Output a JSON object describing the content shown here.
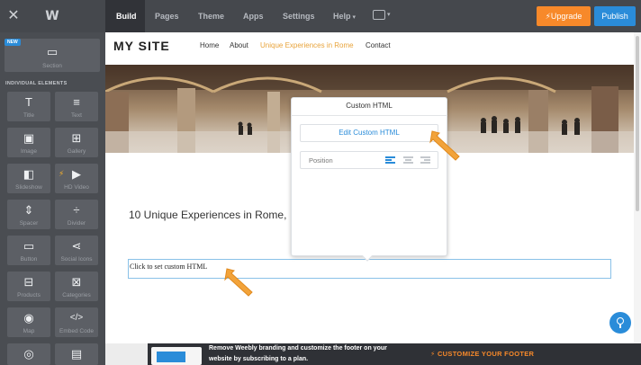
{
  "topbar": {
    "close_icon": "close-icon",
    "logo_icon": "weebly-logo",
    "tabs": [
      {
        "label": "Build"
      },
      {
        "label": "Pages"
      },
      {
        "label": "Theme"
      },
      {
        "label": "Apps"
      },
      {
        "label": "Settings"
      },
      {
        "label": "Help"
      }
    ],
    "upgrade_label": "Upgrade",
    "publish_label": "Publish",
    "colors": {
      "bar": "#45484d",
      "upgrade": "#f7892a",
      "publish": "#2a8cd9"
    }
  },
  "sidebar": {
    "new_badge": "NEW",
    "section_label": "Section",
    "heading": "INDIVIDUAL ELEMENTS",
    "elements": [
      {
        "label": "Title",
        "icon": "T"
      },
      {
        "label": "Text",
        "icon": "≡"
      },
      {
        "label": "Image",
        "icon": "▣"
      },
      {
        "label": "Gallery",
        "icon": "⊞"
      },
      {
        "label": "Slideshow",
        "icon": "◧"
      },
      {
        "label": "HD Video",
        "icon": "▶"
      },
      {
        "label": "Spacer",
        "icon": "⇕"
      },
      {
        "label": "Divider",
        "icon": "÷"
      },
      {
        "label": "Button",
        "icon": "▭"
      },
      {
        "label": "Social Icons",
        "icon": "⋖"
      },
      {
        "label": "Products",
        "icon": "⊟"
      },
      {
        "label": "Categories",
        "icon": "⊠"
      },
      {
        "label": "Map",
        "icon": "◉"
      },
      {
        "label": "Embed Code",
        "icon": "</>"
      },
      {
        "label": "",
        "icon": "◎"
      },
      {
        "label": "",
        "icon": "▤"
      }
    ]
  },
  "site": {
    "title": "MY SITE",
    "nav": [
      {
        "label": "Home"
      },
      {
        "label": "About"
      },
      {
        "label": "Unique Experiences in Rome"
      },
      {
        "label": "Contact"
      }
    ],
    "heading": "10 Unique Experiences in Rome,",
    "custom_html_placeholder": "Click to set custom HTML"
  },
  "popup": {
    "title": "Custom HTML",
    "edit_button": "Edit Custom HTML",
    "position_label": "Position"
  },
  "footer": {
    "message_line1": "Remove Weebly branding and customize the footer on your",
    "message_line2": "website by subscribing to a plan.",
    "cta": "CUSTOMIZE YOUR FOOTER"
  }
}
